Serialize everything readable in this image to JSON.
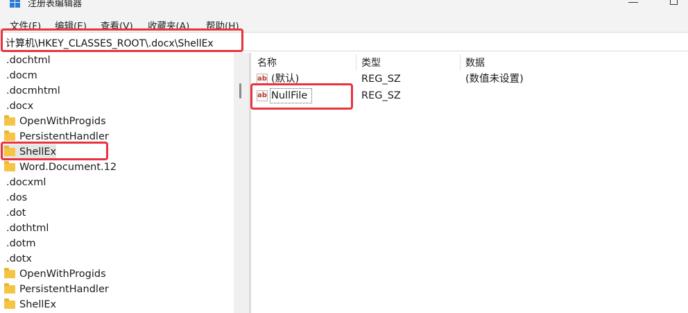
{
  "window": {
    "title": "注册表编辑器"
  },
  "menu": [
    "文件(F)",
    "编辑(E)",
    "查看(V)",
    "收藏夹(A)",
    "帮助(H)"
  ],
  "address": "计算机\\HKEY_CLASSES_ROOT\\.docx\\ShellEx",
  "tree": [
    {
      "label": ".dochtml",
      "folder": false
    },
    {
      "label": ".docm",
      "folder": false
    },
    {
      "label": ".docmhtml",
      "folder": false
    },
    {
      "label": ".docx",
      "folder": false
    },
    {
      "label": "OpenWithProgids",
      "folder": true
    },
    {
      "label": "PersistentHandler",
      "folder": true
    },
    {
      "label": "ShellEx",
      "folder": true,
      "selected": true
    },
    {
      "label": "Word.Document.12",
      "folder": true
    },
    {
      "label": ".docxml",
      "folder": false
    },
    {
      "label": ".dos",
      "folder": false
    },
    {
      "label": ".dot",
      "folder": false
    },
    {
      "label": ".dothtml",
      "folder": false
    },
    {
      "label": ".dotm",
      "folder": false
    },
    {
      "label": ".dotx",
      "folder": false
    },
    {
      "label": "OpenWithProgids",
      "folder": true
    },
    {
      "label": "PersistentHandler",
      "folder": true
    },
    {
      "label": "ShellEx",
      "folder": true
    }
  ],
  "list": {
    "columns": [
      "名称",
      "类型",
      "数据"
    ],
    "rows": [
      {
        "name": "(默认)",
        "type": "REG_SZ",
        "data": "(数值未设置)"
      },
      {
        "name": "NullFile",
        "type": "REG_SZ",
        "data": ""
      }
    ]
  },
  "icons": {
    "value": "ab",
    "folder": "folder-icon"
  },
  "colors": {
    "highlight": "#e8323c",
    "folder": "#f6c445"
  }
}
